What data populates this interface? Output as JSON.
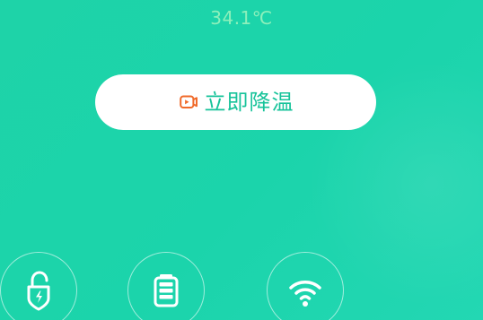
{
  "header": {
    "temperature": "34.1℃"
  },
  "cooling": {
    "button_label": "立即降温",
    "icon": "cooling-camera-icon"
  },
  "actions": [
    {
      "name": "unlock-security",
      "icon": "unlock-security-icon"
    },
    {
      "name": "battery",
      "icon": "battery-icon"
    },
    {
      "name": "wifi",
      "icon": "wifi-icon"
    }
  ],
  "colors": {
    "background": "#1ed3a8",
    "temperature_text": "#8cf0bb",
    "button_text": "#17c39a",
    "button_icon": "#f06a2a",
    "white": "#ffffff"
  }
}
